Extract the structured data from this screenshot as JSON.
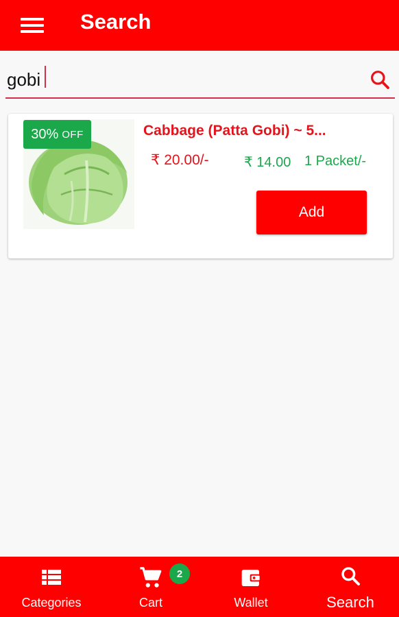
{
  "header": {
    "title": "Search"
  },
  "search": {
    "value": "gobi"
  },
  "results": [
    {
      "discount_pct": "30%",
      "discount_off": "OFF",
      "name": "Cabbage (Patta Gobi) ~ 5...",
      "mrp": "₹ 20.00/-",
      "price": "₹ 14.00",
      "unit": "1 Packet/-",
      "add_label": "Add"
    }
  ],
  "bottom_nav": {
    "categories": "Categories",
    "cart": "Cart",
    "cart_count": "2",
    "wallet": "Wallet",
    "search": "Search"
  },
  "colors": {
    "brand_red": "#ff0000",
    "price_red": "#e3141b",
    "offer_green": "#1aa84b",
    "underline": "#d32f4b"
  }
}
